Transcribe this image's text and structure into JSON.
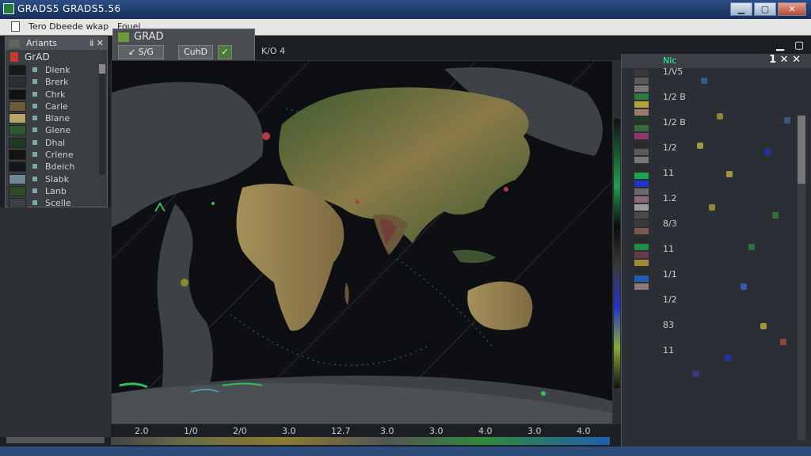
{
  "window": {
    "title": "GRADS5  GRADS5.56",
    "minimize": "▁",
    "maximize": "▢",
    "close": "✕"
  },
  "menubar": {
    "items": "Tero   Dbeede   wkap",
    "extra": "Fouel"
  },
  "layers_panel": {
    "title": "Ariants",
    "controls": "ⅱ ✕",
    "root_label": "GrAD",
    "layers": [
      {
        "label": "Dlenk",
        "color": "#151a18"
      },
      {
        "label": "Brerk",
        "color": "#2a2f33"
      },
      {
        "label": "Chrk",
        "color": "#101212"
      },
      {
        "label": "Carle",
        "color": "#6b5b3c"
      },
      {
        "label": "Blane",
        "color": "#b7a46a"
      },
      {
        "label": "Glene",
        "color": "#2d5a33"
      },
      {
        "label": "Dhal",
        "color": "#1d3b22"
      },
      {
        "label": "Crlene",
        "color": "#111211"
      },
      {
        "label": "Bdeich",
        "color": "#11171a"
      },
      {
        "label": "Slabk",
        "color": "#6f8a92"
      },
      {
        "label": "Lanb",
        "color": "#2e4a28"
      },
      {
        "label": "Scelle",
        "color": "#3b3f44"
      }
    ]
  },
  "toolbar": {
    "title": "GRAD",
    "btn_scale": "↙ S/G",
    "btn_cuhd": "CuhD",
    "btn_ok": "✓"
  },
  "coordinate_readout": "K/O  4",
  "axis_labels": [
    "2.0",
    "1/0",
    "2/0",
    "3.0",
    "12.7",
    "3.0",
    "3.0",
    "4.0",
    "3.0",
    "4.0"
  ],
  "right_panel": {
    "title": "Nlc",
    "close_controls": "1 ✕  ✕",
    "values": [
      "1/V5",
      "1/2 B",
      "1/2 B",
      "1/2",
      "11",
      "1.2",
      "8/3",
      "11",
      "1/1",
      "1/2",
      "83",
      "11"
    ],
    "swatches": [
      "#3a3a3a",
      "#5a5a5a",
      "#777",
      "#2f7a3a",
      "#b4a43a",
      "#9a7a6a",
      "#1f3b22",
      "#3b6a3a",
      "#8a3a6a",
      "#2a2a2a",
      "#5a5a5a",
      "#777",
      "#2a2a2a",
      "#1ba64a",
      "#2233cc",
      "#6a6a6a",
      "#8a6a7a",
      "#9a9a9a",
      "#4a4a4a",
      "#3a3a3a",
      "#7a5a4a",
      "#2a2a2a",
      "#1e8e3e",
      "#6a3a4a",
      "#9a8a3a",
      "#2a2a2a",
      "#1e5fb0",
      "#8a7a7a"
    ]
  },
  "colors": {
    "accent": "#1f3a68",
    "land_light": "#9b8a55",
    "land_green": "#3c5a2e",
    "ocean": "#0d0f12",
    "highlight": "#b23a48"
  }
}
